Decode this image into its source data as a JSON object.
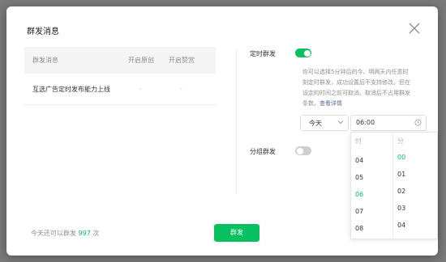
{
  "dialog": {
    "title": "群发消息"
  },
  "table": {
    "headers": [
      "群发消息",
      "开启原创",
      "开启赞赏"
    ],
    "rows": [
      {
        "name": "互选广告定时发布能力上线",
        "original": "-",
        "reward": "-"
      }
    ]
  },
  "schedule": {
    "label": "定时群发",
    "enabled": true,
    "desc_lines": [
      "你可以选择5分钟后的今、明两天内任意时",
      "刻定时群发，成功设置后不支持修改。但在",
      "设定的时间之前可取消。取消后不占用群发"
    ],
    "desc_last": "条数。",
    "detail_link": "查看详情",
    "day_value": "今天",
    "time_value": "06:00"
  },
  "time_picker": {
    "hour_header": "时",
    "minute_header": "分",
    "hours": [
      "04",
      "05",
      "06",
      "07",
      "08"
    ],
    "selected_hour": "06",
    "minutes": [
      "00",
      "01",
      "02",
      "03",
      "04"
    ],
    "selected_minute": "00"
  },
  "group_send": {
    "label": "分组群发",
    "enabled": false
  },
  "footer": {
    "remaining_prefix": "今天还可以群发",
    "remaining_count": "997",
    "remaining_suffix": "次",
    "send_label": "群发"
  },
  "colors": {
    "accent": "#07c160",
    "link": "#576b95",
    "muted": "#8f8f8f"
  },
  "icons": {
    "close": "close-icon",
    "dropdown": "chevron-down-icon",
    "clock": "clock-icon"
  }
}
